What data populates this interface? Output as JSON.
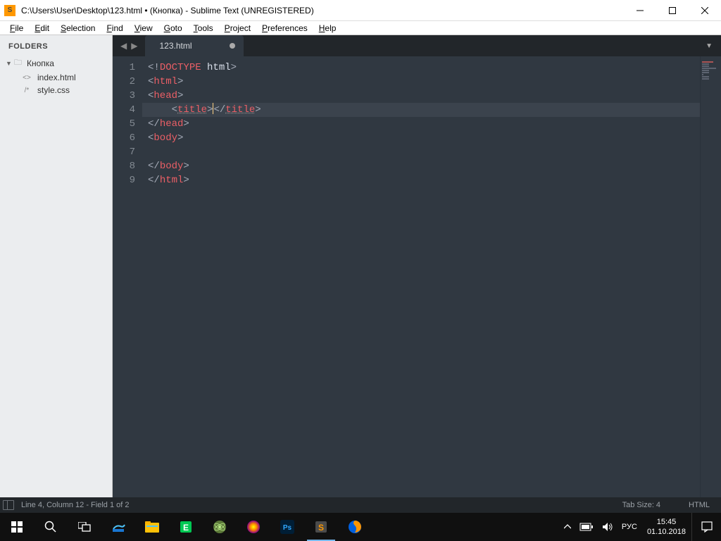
{
  "titlebar": {
    "icon_letter": "S",
    "title": "C:\\Users\\User\\Desktop\\123.html • (Кнопка) - Sublime Text (UNREGISTERED)"
  },
  "menubar": {
    "items": [
      "File",
      "Edit",
      "Selection",
      "Find",
      "View",
      "Goto",
      "Tools",
      "Project",
      "Preferences",
      "Help"
    ]
  },
  "sidebar": {
    "header": "FOLDERS",
    "root": "Кнопка",
    "files": [
      {
        "icon": "<>",
        "name": "index.html"
      },
      {
        "icon": "/*",
        "name": "style.css"
      }
    ]
  },
  "tabs": {
    "items": [
      {
        "name": "123.html",
        "dirty": true
      }
    ]
  },
  "code": {
    "lines": [
      {
        "n": 1,
        "tokens": [
          [
            "punc",
            "<!"
          ],
          [
            "doctype",
            "DOCTYPE"
          ],
          [
            "text",
            " "
          ],
          [
            "doctxt",
            "html"
          ],
          [
            "punc",
            ">"
          ]
        ]
      },
      {
        "n": 2,
        "tokens": [
          [
            "punc",
            "<"
          ],
          [
            "tag",
            "html"
          ],
          [
            "punc",
            ">"
          ]
        ]
      },
      {
        "n": 3,
        "tokens": [
          [
            "punc",
            "<"
          ],
          [
            "tag",
            "head"
          ],
          [
            "punc",
            ">"
          ]
        ]
      },
      {
        "n": 4,
        "tokens": [
          [
            "text",
            "    "
          ],
          [
            "punc",
            "<"
          ],
          [
            "tagu",
            "title"
          ],
          [
            "punc",
            ">"
          ],
          [
            "cursor",
            ""
          ],
          [
            "punc",
            "</"
          ],
          [
            "tagu",
            "title"
          ],
          [
            "punc",
            ">"
          ]
        ]
      },
      {
        "n": 5,
        "tokens": [
          [
            "punc",
            "</"
          ],
          [
            "tag",
            "head"
          ],
          [
            "punc",
            ">"
          ]
        ]
      },
      {
        "n": 6,
        "tokens": [
          [
            "punc",
            "<"
          ],
          [
            "tag",
            "body"
          ],
          [
            "punc",
            ">"
          ]
        ]
      },
      {
        "n": 7,
        "tokens": []
      },
      {
        "n": 8,
        "tokens": [
          [
            "punc",
            "</"
          ],
          [
            "tag",
            "body"
          ],
          [
            "punc",
            ">"
          ]
        ]
      },
      {
        "n": 9,
        "tokens": [
          [
            "punc",
            "</"
          ],
          [
            "tag",
            "html"
          ],
          [
            "punc",
            ">"
          ]
        ]
      }
    ],
    "current_line": 4
  },
  "statusbar": {
    "position": "Line 4, Column 12 - Field 1 of 2",
    "tab_size": "Tab Size: 4",
    "syntax": "HTML"
  },
  "taskbar": {
    "lang": "РУС",
    "time": "15:45",
    "date": "01.10.2018"
  }
}
